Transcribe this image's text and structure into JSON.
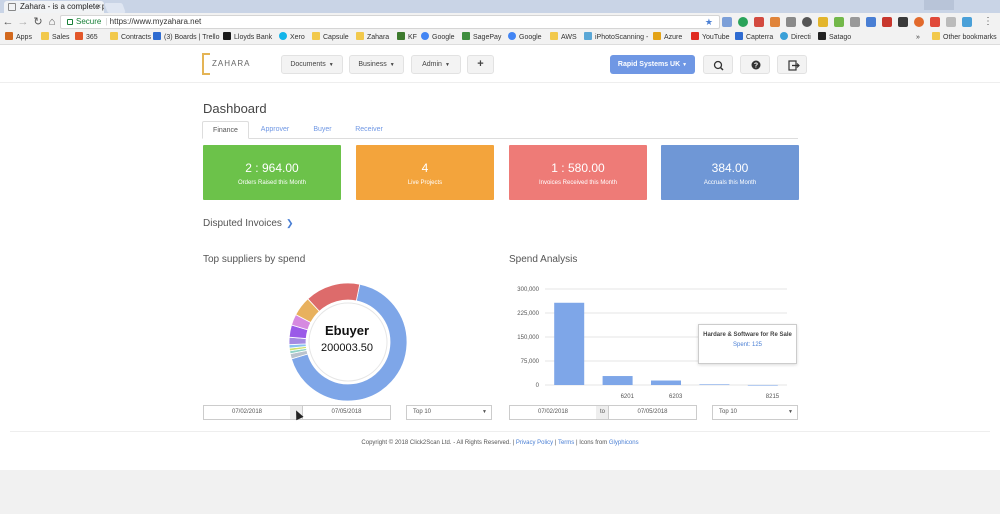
{
  "browser": {
    "tab_title": "Zahara - is a complete p",
    "address_secure": "Secure",
    "address_url": "https://www.myzahara.net",
    "bookmarks": [
      "Apps",
      "Sales",
      "365",
      "Contracts",
      "(3) Boards | Trello",
      "Lloyds Bank",
      "Xero",
      "Capsule",
      "Zahara",
      "KF",
      "Google",
      "SagePay",
      "Google",
      "AWS",
      "iPhotoScanning -",
      "Azure",
      "YouTube",
      "Capterra",
      "Directi",
      "Satago"
    ],
    "other_bookmarks": "Other bookmarks"
  },
  "header": {
    "logo_text": "ZAHARA",
    "menus": [
      "Documents",
      "Business",
      "Admin"
    ],
    "add_label": "+",
    "company": "Rapid Systems UK"
  },
  "dashboard": {
    "title": "Dashboard",
    "tabs": [
      "Finance",
      "Approver",
      "Buyer",
      "Receiver"
    ],
    "cards": [
      {
        "value": "2 : 964.00",
        "label": "Orders Raised this Month",
        "color": "#6cc24a"
      },
      {
        "value": "4",
        "label": "Live Projects",
        "color": "#f3a43c"
      },
      {
        "value": "1 : 580.00",
        "label": "Invoices Received this Month",
        "color": "#ee7b77"
      },
      {
        "value": "384.00",
        "label": "Accruals this Month",
        "color": "#6f97d6"
      }
    ],
    "disputed": "Disputed Invoices"
  },
  "suppliers": {
    "title": "Top suppliers by spend",
    "center_name": "Ebuyer",
    "center_value": "200003.50",
    "date_from": "07/02/2018",
    "date_to": "07/05/2018",
    "top": "Top 10"
  },
  "spend": {
    "title": "Spend Analysis",
    "date_from": "07/02/2018",
    "date_sep": "to",
    "date_to": "07/05/2018",
    "top": "Top 10",
    "tooltip_title": "Hardare & Software for Re Sale",
    "tooltip_value": "Spent: 125"
  },
  "footer": {
    "copyright": "Copyright © 2018 Click2Scan Ltd. - All Rights Reserved.",
    "privacy": "Privacy Policy",
    "terms": "Terms",
    "icons_prefix": "Icons from",
    "icons_link": "Glyphicons"
  },
  "chart_data": [
    {
      "type": "pie",
      "title": "Top suppliers by spend",
      "slices": [
        {
          "name": "Ebuyer",
          "value": 200003.5,
          "color": "#7ea6e8"
        },
        {
          "name": "",
          "value": 4200,
          "color": "#b9c3cd"
        },
        {
          "name": "",
          "value": 2400,
          "color": "#8fd3c7"
        },
        {
          "name": "",
          "value": 2200,
          "color": "#cfe26b"
        },
        {
          "name": "",
          "value": 2800,
          "color": "#89c2f0"
        },
        {
          "name": "",
          "value": 6000,
          "color": "#a48be2"
        },
        {
          "name": "",
          "value": 10000,
          "color": "#9a5ae8"
        },
        {
          "name": "",
          "value": 9000,
          "color": "#d68ae0"
        },
        {
          "name": "",
          "value": 16000,
          "color": "#e8b15e"
        },
        {
          "name": "",
          "value": 45000,
          "color": "#dd6b6b"
        }
      ]
    },
    {
      "type": "bar",
      "title": "Spend Analysis",
      "categories": [
        "",
        "6201",
        "6203",
        "8215"
      ],
      "values": [
        257000,
        28000,
        14000,
        2000,
        125
      ],
      "category_positions": [
        "",
        "6201",
        "6203",
        "",
        "8215"
      ],
      "ylim": [
        0,
        300000
      ],
      "yticks": [
        "300,000",
        "225,000",
        "150,000",
        "75,000",
        "0"
      ],
      "grid": true,
      "color": "#7ea6e8"
    }
  ]
}
